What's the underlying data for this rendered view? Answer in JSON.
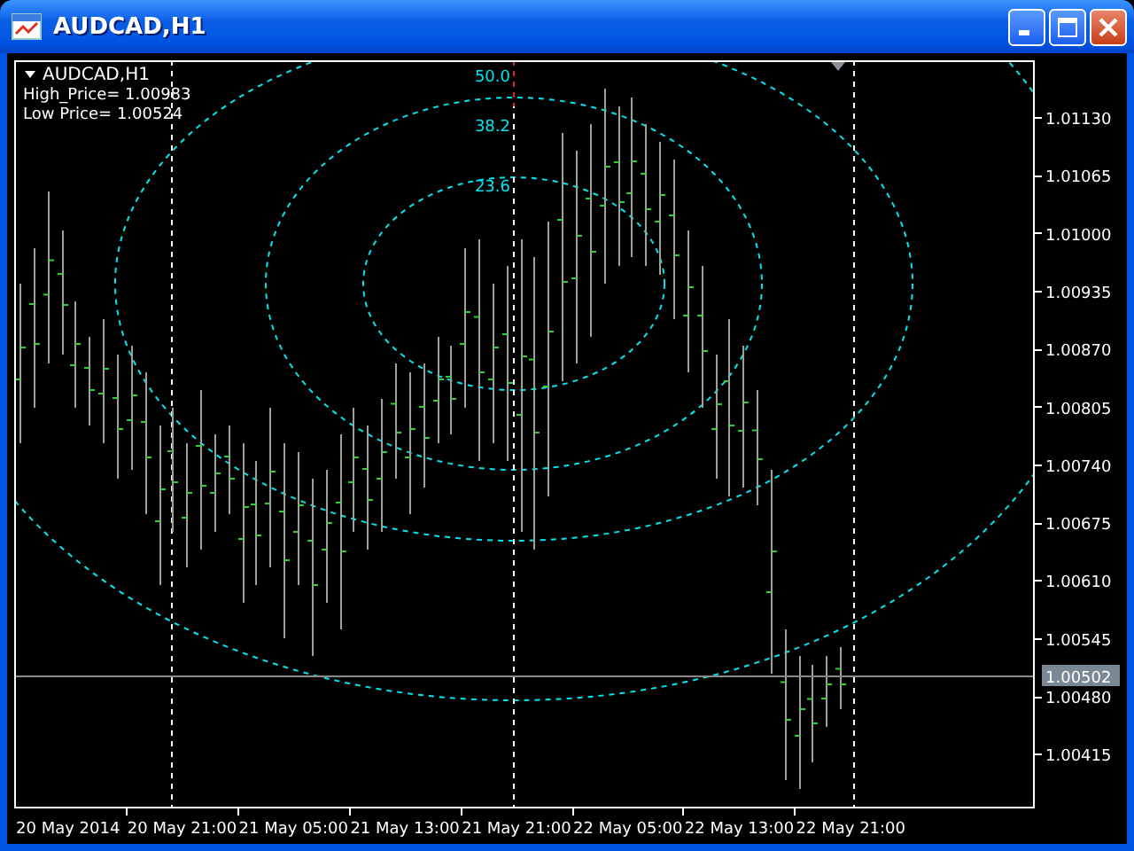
{
  "window": {
    "title": "AUDCAD,H1"
  },
  "chart": {
    "symbol_label": "AUDCAD,H1",
    "info_lines": [
      "High_Price= 1.00983",
      "Low Price= 1.00524"
    ],
    "level_labels": [
      "50.0",
      "38.2",
      "23.6"
    ],
    "price_axis": [
      "1.01130",
      "1.01065",
      "1.01000",
      "1.00935",
      "1.00870",
      "1.00805",
      "1.00740",
      "1.00675",
      "1.00610",
      "1.00545",
      "1.00480",
      "1.00415"
    ],
    "current_price": "1.00502",
    "time_axis": [
      "20 May 2014",
      "20 May 21:00",
      "21 May 05:00",
      "21 May 13:00",
      "21 May 21:00",
      "22 May 05:00",
      "22 May 13:00",
      "22 May 21:00"
    ]
  }
}
